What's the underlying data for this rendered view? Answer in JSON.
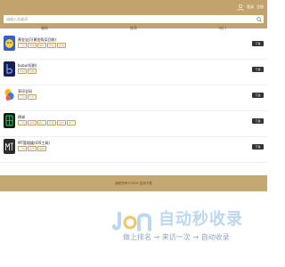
{
  "header": {
    "login_label": "登录",
    "register_label": "注册",
    "bg_color": "#c3a36d"
  },
  "search": {
    "placeholder": "请输入关键词"
  },
  "tabs": [
    {
      "label": "最新"
    },
    {
      "label": "推荐"
    },
    {
      "label": "热门"
    }
  ],
  "apps": [
    {
      "name": "黄金宝贝(黄金购买回收)",
      "icon": "yellow-character-icon",
      "tags": [
        "工具",
        "购物",
        "理财",
        "黄金",
        "回收"
      ],
      "button_label": "下载"
    },
    {
      "name": "bubu(短剧)",
      "icon": "bubu-b-icon",
      "tags": [
        "视频",
        "短剧"
      ],
      "button_label": "下载"
    },
    {
      "name": "享印全码",
      "icon": "colorful-leaf-icon",
      "tags": [
        "工具",
        "打印"
      ],
      "button_label": "下载"
    },
    {
      "name": "德昶",
      "icon": "green-grid-icon",
      "tags": [
        "工具",
        "效率",
        "办公",
        "管理",
        "协作",
        "学习"
      ],
      "button_label": "下载"
    },
    {
      "name": "MT管理器(IOS工具)",
      "icon": "mt-tool-icon",
      "tags": [
        "工具",
        "文件",
        "编辑"
      ],
      "button_label": "下载"
    }
  ],
  "footer": {
    "text": "版权所有©2025 应用下载"
  },
  "watermark": {
    "title": "自动秒收录",
    "subtitle": "做上排名 → 来访一次 → 自动收录"
  }
}
